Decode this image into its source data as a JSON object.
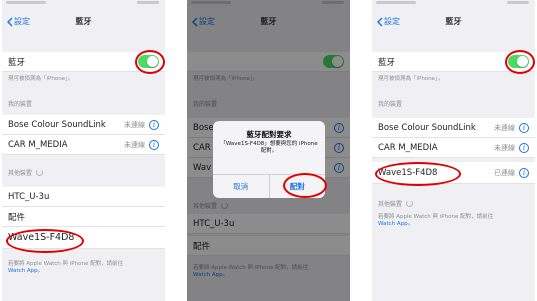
{
  "colors": {
    "accent": "#1a73e8",
    "toggle_on": "#4cd964",
    "highlight": "#e00000"
  },
  "panels": [
    {
      "back_label": "設定",
      "title": "藍牙",
      "bluetooth_label": "藍牙",
      "discoverable_note": "現可被偵測為「iPhone」。",
      "my_devices_header": "我的裝置",
      "my_devices": [
        {
          "name": "Bose Colour SoundLink",
          "status": "未連線"
        },
        {
          "name": "CAR M_MEDIA",
          "status": "未連線"
        }
      ],
      "other_devices_header": "其他裝置",
      "other_devices": [
        {
          "name": "HTC_U-3u"
        },
        {
          "name": "配件"
        },
        {
          "name": "Wave1S-F4D8"
        }
      ],
      "watch_note": "若要將 Apple Watch 與 iPhone 配對，請前往",
      "watch_link": "Watch App。"
    },
    {
      "back_label": "設定",
      "title": "藍牙",
      "discoverable_note": "現可被偵測為「iPhone」。",
      "my_devices_header": "我的裝置",
      "my_devices": [
        {
          "name": "Bose",
          "status": ""
        },
        {
          "name": "CAR",
          "status": ""
        },
        {
          "name": "Wav",
          "status": ""
        }
      ],
      "other_devices_header": "其他裝置",
      "other_devices": [
        {
          "name": "HTC_U-3u"
        },
        {
          "name": "配件"
        }
      ],
      "watch_note": "若要將 Apple Watch 與 iPhone 配對，請前往",
      "watch_link": "Watch App。",
      "alert": {
        "title": "藍牙配對要求",
        "message": "「Wave1S-F4D8」想要與您的 iPhone 配對。",
        "cancel_label": "取消",
        "pair_label": "配對"
      }
    },
    {
      "back_label": "設定",
      "title": "藍牙",
      "bluetooth_label": "藍牙",
      "discoverable_note": "現可被偵測為「iPhone」。",
      "my_devices_header": "我的裝置",
      "my_devices": [
        {
          "name": "Bose Colour SoundLink",
          "status": "未連線"
        },
        {
          "name": "CAR M_MEDIA",
          "status": "未連線"
        },
        {
          "name": "Wave1S-F4D8",
          "status": "已連線"
        }
      ],
      "other_devices_header": "其他裝置",
      "watch_note": "若要將 Apple Watch 與 iPhone 配對，請前往",
      "watch_link": "Watch App。"
    }
  ]
}
